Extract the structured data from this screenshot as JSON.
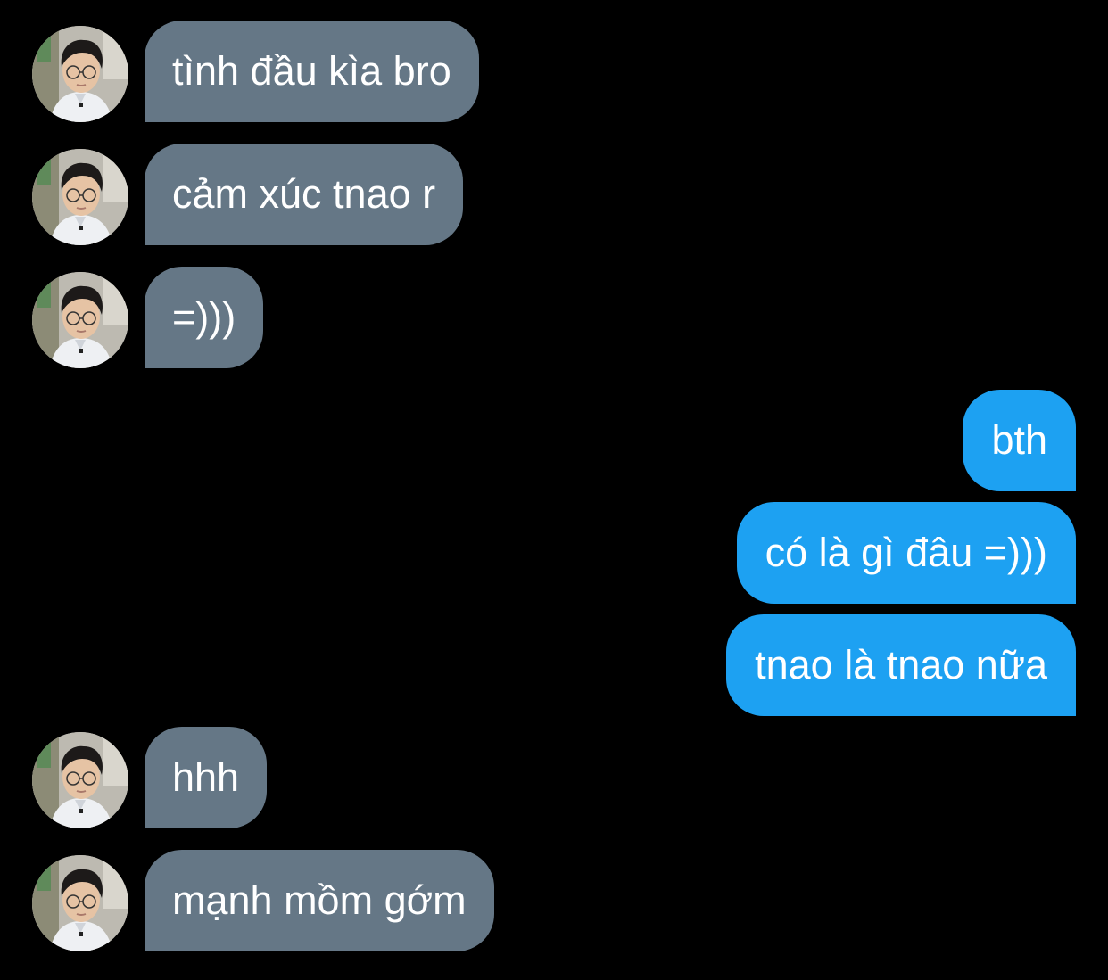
{
  "colors": {
    "background": "#000000",
    "incoming_bubble": "#657786",
    "outgoing_bubble": "#1da1f2",
    "text": "#ffffff"
  },
  "avatar_icon": "contact-avatar-photo",
  "messages": [
    {
      "sender": "contact",
      "text": "tình đầu kìa bro"
    },
    {
      "sender": "contact",
      "text": "cảm xúc tnao r"
    },
    {
      "sender": "contact",
      "text": "=)))"
    },
    {
      "sender": "me",
      "text": "bth"
    },
    {
      "sender": "me",
      "text": "có là gì đâu =)))"
    },
    {
      "sender": "me",
      "text": "tnao là tnao nữa"
    },
    {
      "sender": "contact",
      "text": "hhh"
    },
    {
      "sender": "contact",
      "text": "mạnh mồm gớm"
    }
  ]
}
